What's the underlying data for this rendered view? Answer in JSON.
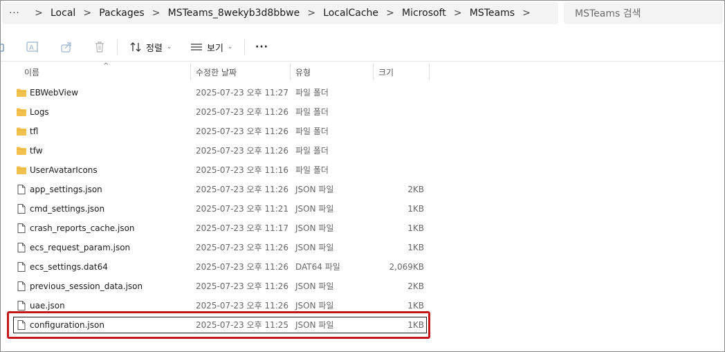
{
  "address": {
    "more": "···",
    "crumbs": [
      "Local",
      "Packages",
      "MSTeams_8wekyb3d8bbwe",
      "LocalCache",
      "Microsoft",
      "MSTeams"
    ],
    "separator": ">"
  },
  "search": {
    "placeholder": "MSTeams 검색"
  },
  "toolbar": {
    "sort_label": "정렬",
    "view_label": "보기",
    "more_label": "···",
    "icons": [
      "new-icon",
      "rename-icon",
      "share-icon",
      "delete-icon",
      "sort-icon",
      "view-icon",
      "more-icon"
    ]
  },
  "columns": {
    "name": "이름",
    "date": "수정한 날짜",
    "type": "유형",
    "size": "크기",
    "sort_caret": "^"
  },
  "files": [
    {
      "name": "EBWebView",
      "date": "2025-07-23 오후 11:27",
      "type": "파일 폴더",
      "size": "",
      "kind": "folder"
    },
    {
      "name": "Logs",
      "date": "2025-07-23 오후 11:26",
      "type": "파일 폴더",
      "size": "",
      "kind": "folder"
    },
    {
      "name": "tfl",
      "date": "2025-07-23 오후 11:26",
      "type": "파일 폴더",
      "size": "",
      "kind": "folder"
    },
    {
      "name": "tfw",
      "date": "2025-07-23 오후 11:26",
      "type": "파일 폴더",
      "size": "",
      "kind": "folder"
    },
    {
      "name": "UserAvatarIcons",
      "date": "2025-07-23 오후 11:16",
      "type": "파일 폴더",
      "size": "",
      "kind": "folder"
    },
    {
      "name": "app_settings.json",
      "date": "2025-07-23 오후 11:26",
      "type": "JSON 파일",
      "size": "2KB",
      "kind": "file"
    },
    {
      "name": "cmd_settings.json",
      "date": "2025-07-23 오후 11:21",
      "type": "JSON 파일",
      "size": "1KB",
      "kind": "file"
    },
    {
      "name": "crash_reports_cache.json",
      "date": "2025-07-23 오후 11:17",
      "type": "JSON 파일",
      "size": "1KB",
      "kind": "file"
    },
    {
      "name": "ecs_request_param.json",
      "date": "2025-07-23 오후 11:26",
      "type": "JSON 파일",
      "size": "1KB",
      "kind": "file"
    },
    {
      "name": "ecs_settings.dat64",
      "date": "2025-07-23 오후 11:26",
      "type": "DAT64 파일",
      "size": "2,069KB",
      "kind": "file"
    },
    {
      "name": "previous_session_data.json",
      "date": "2025-07-23 오후 11:26",
      "type": "JSON 파일",
      "size": "2KB",
      "kind": "file"
    },
    {
      "name": "uae.json",
      "date": "2025-07-23 오후 11:26",
      "type": "JSON 파일",
      "size": "1KB",
      "kind": "file"
    },
    {
      "name": "configuration.json",
      "date": "2025-07-23 오후 11:25",
      "type": "JSON 파일",
      "size": "1KB",
      "kind": "file",
      "selected": true
    }
  ],
  "colors": {
    "folder": "#f2c14e",
    "highlight": "#c4161c",
    "address_bg": "#f3f3f3"
  }
}
